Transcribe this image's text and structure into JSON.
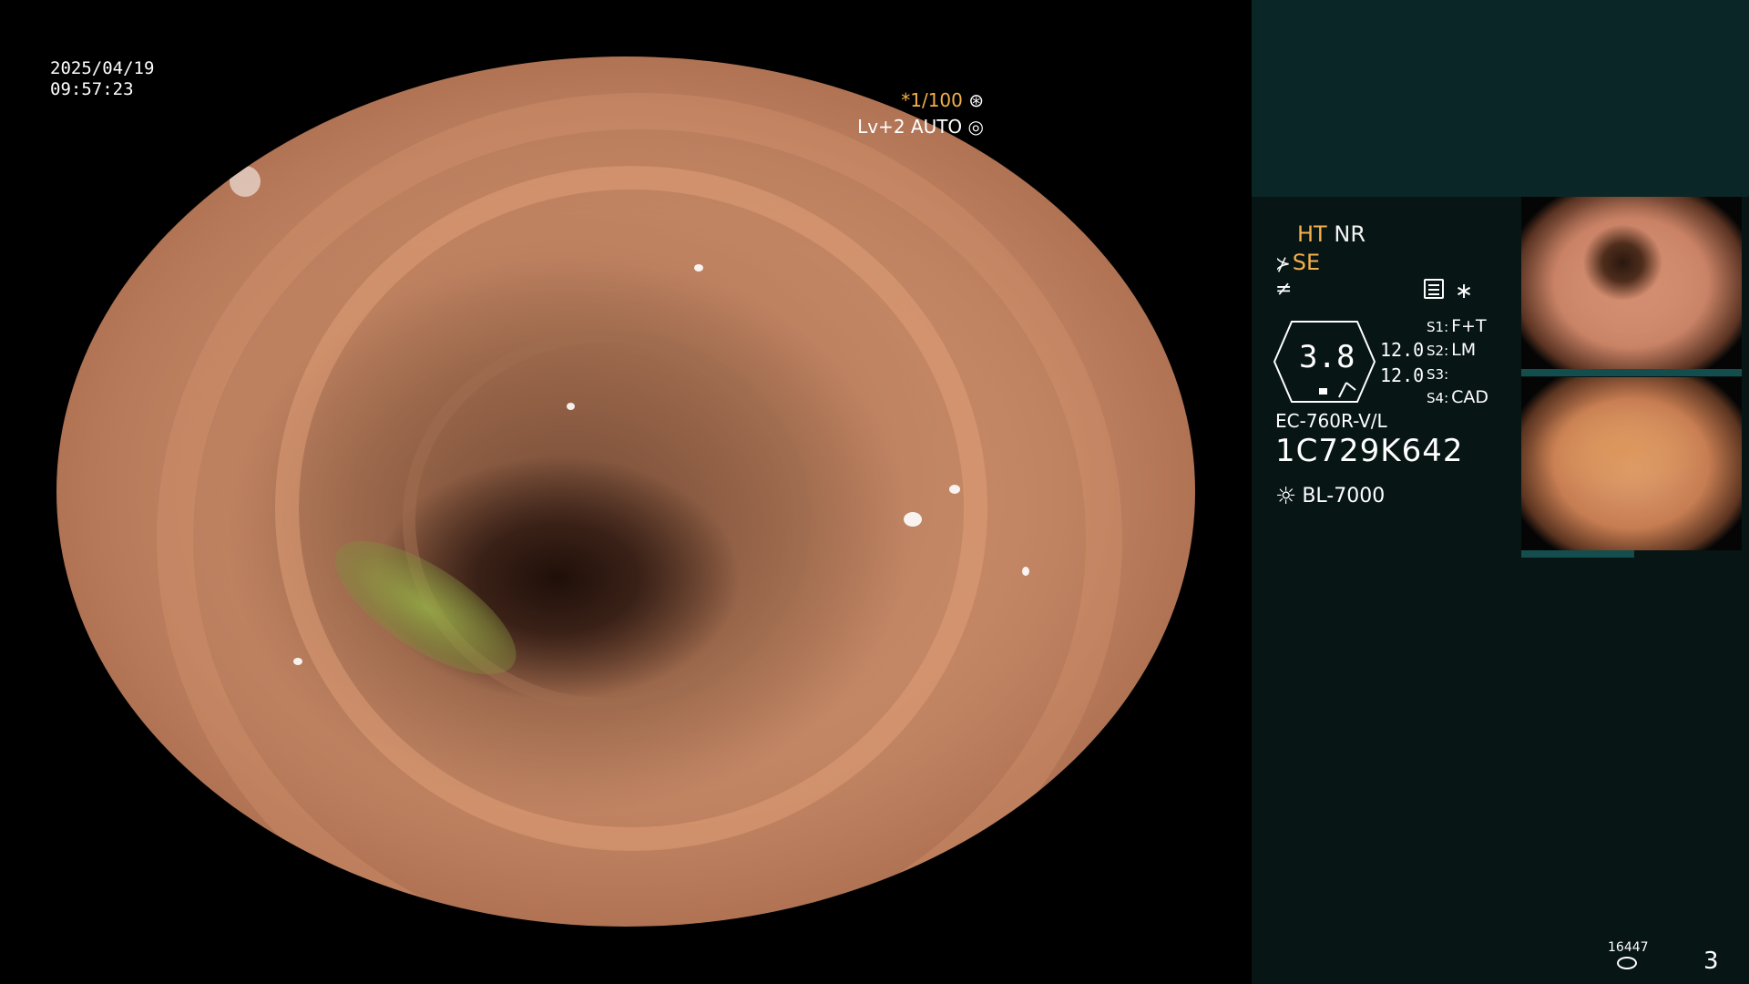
{
  "overlay": {
    "date": "2025/04/19",
    "time": "09:57:23",
    "shutter": "*1/100",
    "auto_level": "Lv+2 AUTO"
  },
  "panel": {
    "ht": "HT",
    "nr": "NR",
    "se": "SE",
    "gauge_value": "3.8",
    "value_1": "12.0",
    "value_2": "12.0",
    "slots": [
      {
        "label": "S1:",
        "value": "F+T"
      },
      {
        "label": "S2:",
        "value": "LM"
      },
      {
        "label": "S3:",
        "value": ""
      },
      {
        "label": "S4:",
        "value": "CAD"
      }
    ],
    "scope_model": "EC-760R-V/L",
    "scope_serial": "1C729K642",
    "light_source": "BL-7000",
    "counter": "16447",
    "page_number": "3"
  },
  "colors": {
    "panel_dark": "#071515",
    "panel_top": "#0b2626",
    "accent_orange": "#f4b04a"
  },
  "icons": [
    "aperture-icon",
    "iris-icon",
    "scope-icon",
    "note-icon",
    "lamp-icon",
    "storage-icon"
  ]
}
